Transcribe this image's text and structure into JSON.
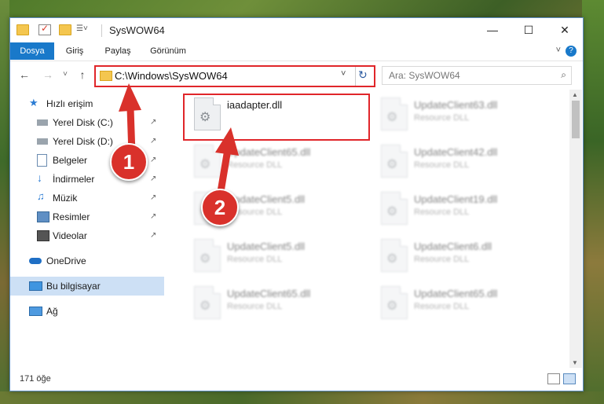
{
  "window": {
    "title": "SysWOW64",
    "controls": {
      "minimize": "—",
      "maximize": "☐",
      "close": "✕"
    }
  },
  "ribbon": {
    "tabs": [
      "Dosya",
      "Giriş",
      "Paylaş",
      "Görünüm"
    ],
    "active_tab": "Dosya",
    "expand_glyph": "˅",
    "help_glyph": "?"
  },
  "navbar": {
    "back_glyph": "←",
    "forward_glyph": "→",
    "recent_glyph": "˅",
    "up_glyph": "↑",
    "address": "C:\\Windows\\SysWOW64",
    "dropdown_glyph": "˅",
    "refresh_glyph": "↻",
    "search_placeholder": "Ara: SysWOW64",
    "search_glyph": "⌕"
  },
  "sidebar": {
    "pin_glyph": "↗",
    "items": [
      {
        "label": "Hızlı erişim",
        "icon": "star-icon",
        "pinned": false
      },
      {
        "label": "Yerel Disk (C:)",
        "icon": "drive-icon",
        "pinned": true
      },
      {
        "label": "Yerel Disk (D:)",
        "icon": "drive-icon",
        "pinned": true
      },
      {
        "label": "Belgeler",
        "icon": "documents-icon",
        "pinned": true
      },
      {
        "label": "İndirmeler",
        "icon": "download-icon",
        "pinned": true
      },
      {
        "label": "Müzik",
        "icon": "music-icon",
        "pinned": true
      },
      {
        "label": "Resimler",
        "icon": "pictures-icon",
        "pinned": true
      },
      {
        "label": "Videolar",
        "icon": "videos-icon",
        "pinned": true
      },
      {
        "label": "OneDrive",
        "icon": "cloud-icon",
        "pinned": false
      },
      {
        "label": "Bu bilgisayar",
        "icon": "computer-icon",
        "pinned": false,
        "selected": true
      },
      {
        "label": "Ağ",
        "icon": "network-icon",
        "pinned": false
      }
    ]
  },
  "files": {
    "gear_glyph": "⚙",
    "items": [
      {
        "name": "iaadapter.dll",
        "type": "",
        "highlighted": true
      },
      {
        "name": "UpdateClient63.dll",
        "type": "Resource DLL",
        "blurred": true
      },
      {
        "name": "UpdateClient65.dll",
        "type": "Resource DLL",
        "blurred": true
      },
      {
        "name": "UpdateClient42.dll",
        "type": "Resource DLL",
        "blurred": true
      },
      {
        "name": "UpdateClient5.dll",
        "type": "Resource DLL",
        "blurred": true
      },
      {
        "name": "UpdateClient19.dll",
        "type": "Resource DLL",
        "blurred": true
      },
      {
        "name": "UpdateClient5.dll",
        "type": "Resource DLL",
        "blurred": true
      },
      {
        "name": "UpdateClient6.dll",
        "type": "Resource DLL",
        "blurred": true
      },
      {
        "name": "UpdateClient65.dll",
        "type": "Resource DLL",
        "blurred": true
      },
      {
        "name": "UpdateClient65.dll",
        "type": "Resource DLL",
        "blurred": true
      }
    ]
  },
  "scrollbar": {
    "up_glyph": "▲",
    "down_glyph": "▼"
  },
  "status": {
    "count": "171 öğe"
  },
  "callouts": [
    "1",
    "2"
  ],
  "colors": {
    "accent": "#1979ca",
    "highlight": "#e0262a",
    "selected": "#cde0f5"
  }
}
